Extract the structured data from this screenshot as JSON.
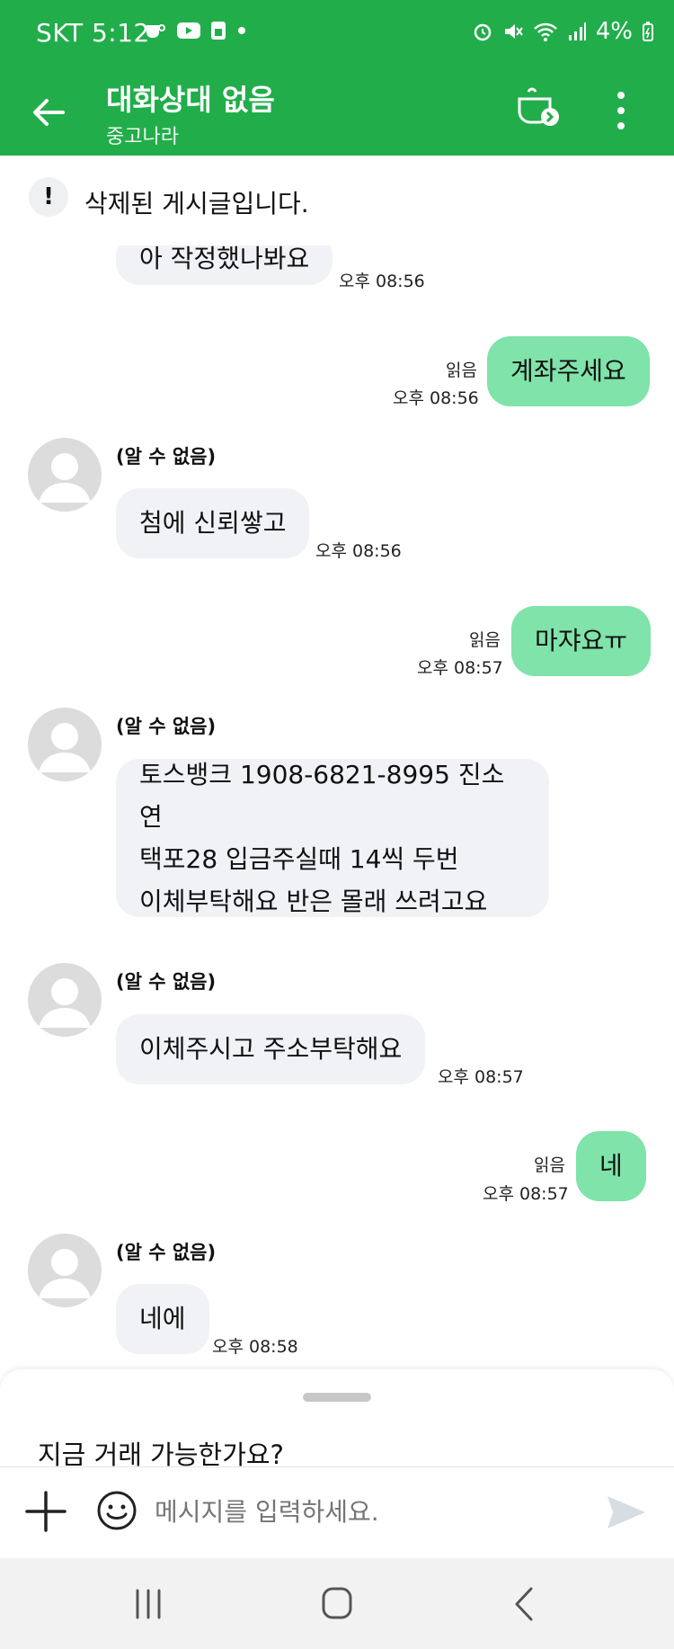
{
  "status_bar": {
    "time": "SKT 5:12",
    "battery": "4%",
    "left_icons": [
      "cup-icon",
      "youtube-icon",
      "app-icon",
      "dot-icon"
    ],
    "right_icons": [
      "alarm-icon",
      "mute-icon",
      "wifi-icon",
      "signal-icon",
      "battery-icon"
    ]
  },
  "header": {
    "title": "대화상대 없음",
    "subtitle": "중고나라",
    "back_icon": "back-arrow-icon",
    "badge_icon": "cup-next-icon",
    "more_icon": "more-vertical-icon"
  },
  "notice": {
    "icon": "exclamation-icon",
    "text": "삭제된 게시글입니다."
  },
  "messages": [
    {
      "direction": "in",
      "text": "아 작정했나봐요",
      "time": "오후 08:56",
      "sender": ""
    },
    {
      "direction": "out",
      "text": "계좌주세요",
      "time": "오후 08:56",
      "read": "읽음"
    },
    {
      "direction": "in",
      "sender": "(알 수 없음)",
      "text": "첨에 신뢰쌓고",
      "time": "오후 08:56"
    },
    {
      "direction": "out",
      "text": "마쟈요ㅠ",
      "time": "오후 08:57",
      "read": "읽음"
    },
    {
      "direction": "in",
      "sender": "(알 수 없음)",
      "lines": [
        "토스뱅크 1908-6821-8995 진소연",
        "택포28  입금주실때 14씩 두번",
        "이체부탁해요 반은 몰래 쓰려고요"
      ]
    },
    {
      "direction": "in",
      "sender": "(알 수 없음)",
      "text": "이체주시고 주소부탁해요",
      "time": "오후 08:57"
    },
    {
      "direction": "out",
      "text": "네",
      "time": "오후 08:57",
      "read": "읽음"
    },
    {
      "direction": "in",
      "sender": "(알 수 없음)",
      "text": "네에",
      "time": "오후 08:58"
    }
  ],
  "bottom_sheet": {
    "suggestion": "지금 거래 가능한가요?"
  },
  "composer": {
    "placeholder": "메시지를 입력하세요.",
    "plus_icon": "plus-icon",
    "emoji_icon": "emoji-icon",
    "send_icon": "send-icon"
  },
  "nav_bar": {
    "icons": [
      "recent-apps-icon",
      "home-icon",
      "back-icon"
    ]
  },
  "colors": {
    "brand_green": "#22ad4b",
    "outgoing_bubble": "#7fe3aa",
    "incoming_bubble": "#f0f2f5"
  }
}
